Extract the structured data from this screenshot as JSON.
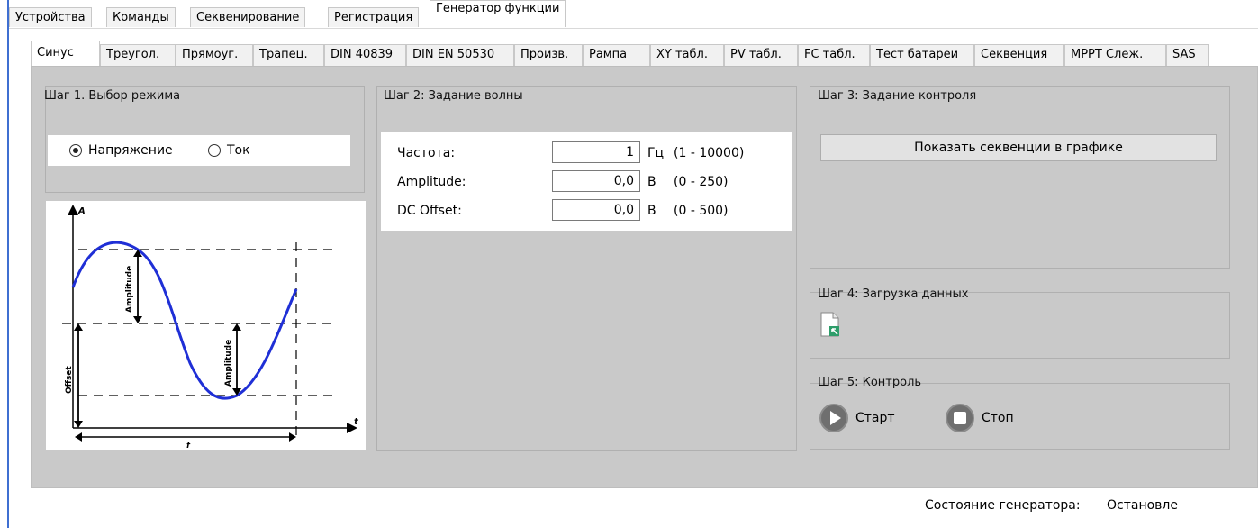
{
  "top_tabs": [
    "Устройства",
    "Команды",
    "Секвенирование",
    "Регистрация",
    "Генератор функции"
  ],
  "sub_tabs": [
    "Синус",
    "Треугол.",
    "Прямоуг.",
    "Трапец.",
    "DIN 40839",
    "DIN EN 50530",
    "Произв.",
    "Рампа",
    "XY табл.",
    "PV табл.",
    "FC табл.",
    "Тест батареи",
    "Секвенция",
    "MPPT Слеж.",
    "SAS"
  ],
  "step1": {
    "title": "Шаг 1. Выбор режима",
    "radio_voltage": "Напряжение",
    "radio_current": "Ток",
    "selected": "Напряжение"
  },
  "graph": {
    "axis_a": "A",
    "axis_t": "t",
    "label_amplitude_1": "Amplitude",
    "label_amplitude_2": "Amplitude",
    "label_offset": "Offset",
    "label_f": "f"
  },
  "step2": {
    "title": "Шаг 2: Задание волны",
    "fields": [
      {
        "label": "Частота:",
        "value": "1",
        "unit": "Гц",
        "range": "(1 - 10000)"
      },
      {
        "label": "Amplitude:",
        "value": "0,0",
        "unit": "В",
        "range": "(0 - 250)"
      },
      {
        "label": "DC Offset:",
        "value": "0,0",
        "unit": "В",
        "range": "(0 - 500)"
      }
    ]
  },
  "step3": {
    "title": "Шаг 3: Задание контроля",
    "show_button": "Показать секвенции в графике"
  },
  "step4": {
    "title": "Шаг 4: Загрузка данных"
  },
  "step5": {
    "title": "Шаг 5: Контроль",
    "start_label": "Старт",
    "stop_label": "Стоп"
  },
  "status": {
    "label": "Состояние генератора:",
    "value": "Остановле"
  },
  "colors": {
    "panel_bg": "#c9c9c9",
    "wave_blue": "#1f2fd6",
    "left_border": "#3f6fd1"
  }
}
